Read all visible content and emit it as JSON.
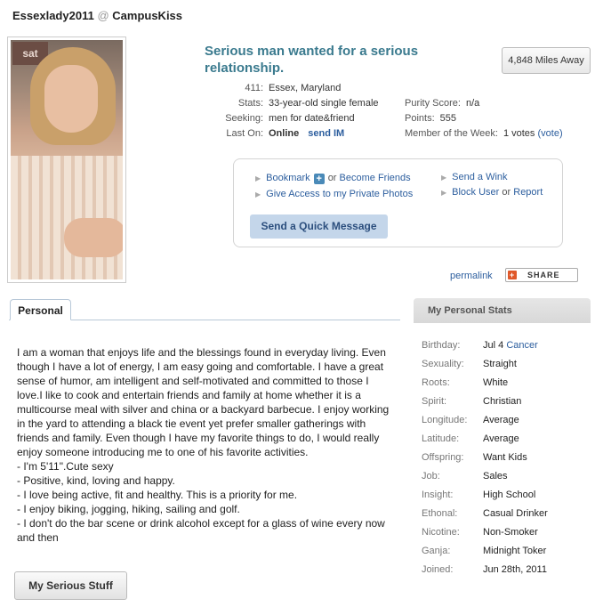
{
  "header": {
    "username": "Essexlady2011",
    "at": "@",
    "site": "CampusKiss"
  },
  "photo": {
    "sign_text": "sat"
  },
  "headline": "Serious man wanted for a serious relationship.",
  "distance": "4,848 Miles Away",
  "info": {
    "id_label": "411:",
    "id_value": "Essex, Maryland",
    "stats_label": "Stats:",
    "stats_value": "33-year-old single female",
    "seeking_label": "Seeking:",
    "seeking_value": "men for date&friend",
    "laston_label": "Last On:",
    "laston_value": "Online",
    "send_im": "send IM",
    "purity_label": "Purity Score:",
    "purity_value": "n/a",
    "points_label": "Points:",
    "points_value": "555",
    "motw_label": "Member of the Week:",
    "motw_value": "1 votes",
    "motw_vote": "(vote)"
  },
  "actions": {
    "bookmark": "Bookmark",
    "plus": "+",
    "or": "or",
    "become_friends": "Become Friends",
    "give_access": "Give Access to my Private Photos",
    "send_wink": "Send a Wink",
    "block_user": "Block User",
    "report": "Report",
    "quick_message": "Send a Quick Message"
  },
  "permalink": "permalink",
  "share": {
    "icon": "+",
    "label": "SHARE"
  },
  "tab_personal": "Personal",
  "stats_heading": "My Personal Stats",
  "bio": {
    "para": "I am a woman that enjoys life and the blessings found in everyday living. Even though I have a lot of energy, I am easy going and comfortable. I have a great sense of humor, am intelligent and self-motivated and committed to those I love.I like to cook and entertain friends and family at home whether it is a multicourse meal with silver and china or a backyard barbecue. I enjoy working in the yard to attending a black tie event yet prefer smaller gatherings with friends and family. Even though I have my favorite things to do, I would really enjoy someone introducing me to one of his favorite activities.",
    "lines": [
      "- I'm 5'11\".Cute sexy",
      "- Positive, kind, loving and happy.",
      "- I love being active, fit and healthy. This is a priority for me.",
      "- I enjoy biking, jogging, hiking, sailing and golf.",
      "- I don't do the bar scene or drink alcohol except for a glass of wine every now and then"
    ]
  },
  "serious_button": "My Serious Stuff",
  "stats": [
    {
      "k": "Birthday:",
      "v": "Jul 4",
      "link": "Cancer"
    },
    {
      "k": "Sexuality:",
      "v": "Straight"
    },
    {
      "k": "Roots:",
      "v": "White"
    },
    {
      "k": "Spirit:",
      "v": "Christian"
    },
    {
      "k": "Longitude:",
      "v": "Average"
    },
    {
      "k": "Latitude:",
      "v": "Average"
    },
    {
      "k": "Offspring:",
      "v": "Want Kids"
    },
    {
      "k": "Job:",
      "v": "Sales"
    },
    {
      "k": "Insight:",
      "v": "High School"
    },
    {
      "k": "Ethonal:",
      "v": "Casual Drinker"
    },
    {
      "k": "Nicotine:",
      "v": "Non-Smoker"
    },
    {
      "k": "Ganja:",
      "v": "Midnight Toker"
    },
    {
      "k": "Joined:",
      "v": "Jun 28th, 2011"
    }
  ]
}
